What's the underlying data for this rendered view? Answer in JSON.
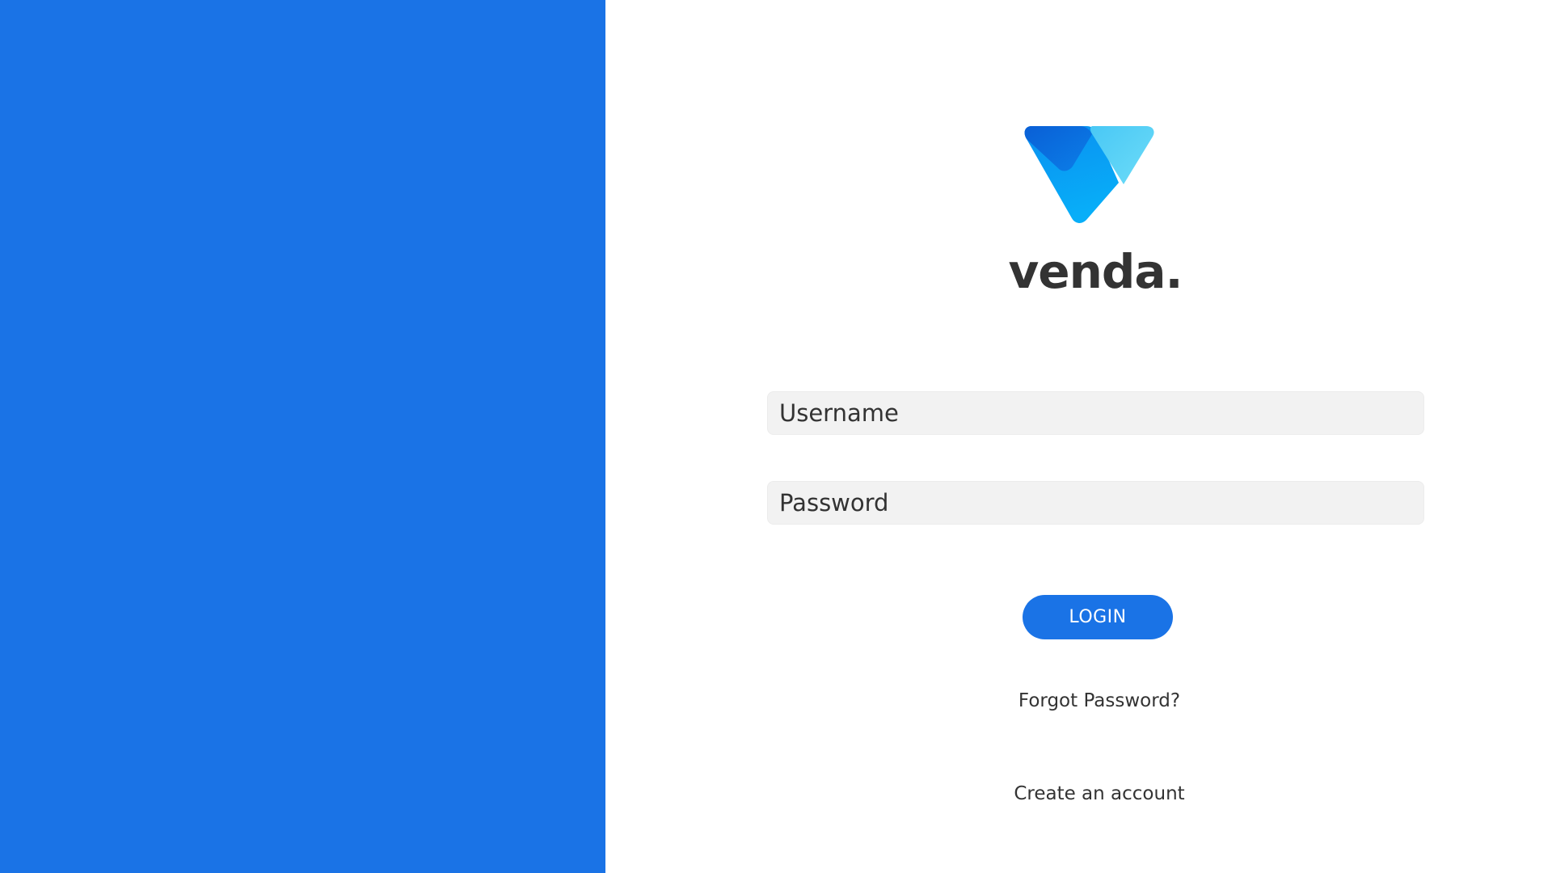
{
  "brand": {
    "name": "venda.",
    "logo_icon": "venda-v-logo-icon",
    "colors": {
      "primary": "#1a73e6",
      "logo_dark": "#0a5fd6",
      "logo_mid": "#0a9bf5",
      "logo_light": "#5ad7f7"
    }
  },
  "login_form": {
    "username": {
      "placeholder": "Username",
      "value": ""
    },
    "password": {
      "placeholder": "Password",
      "value": ""
    },
    "login_label": "LOGIN",
    "forgot_password_label": "Forgot Password?",
    "create_account_label": "Create an account"
  },
  "layout_colors": {
    "left_panel": "#1a73e6",
    "input_background": "#f2f2f2",
    "text": "#333333"
  }
}
